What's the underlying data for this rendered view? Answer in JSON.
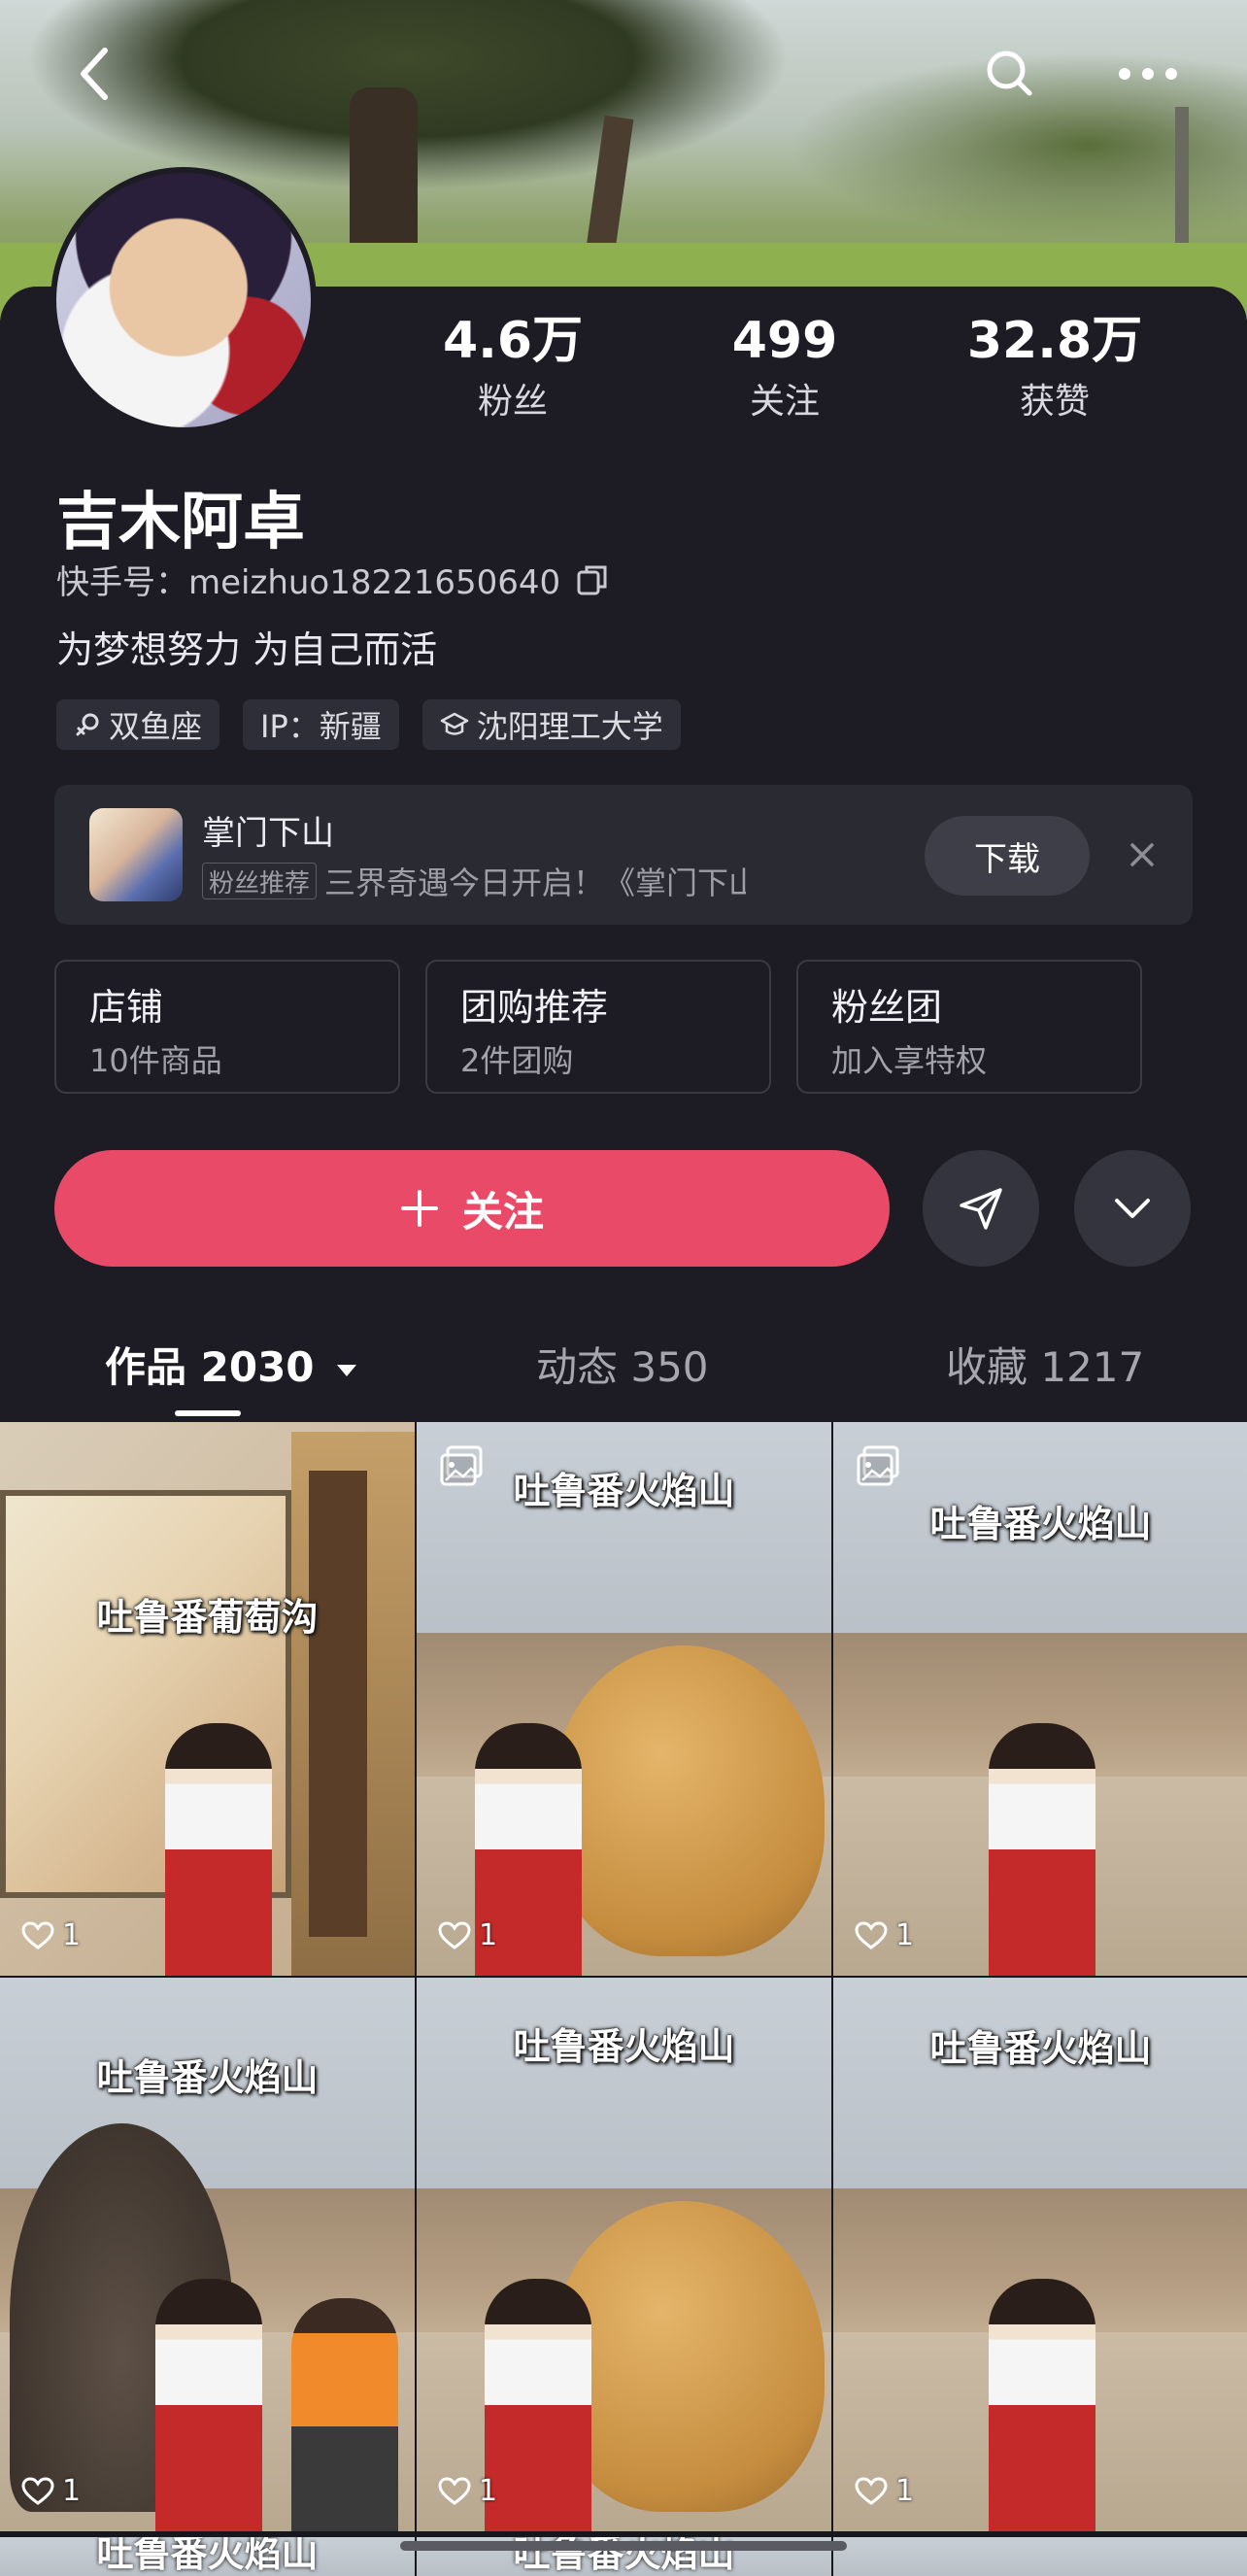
{
  "nav": {
    "back_icon": "chevron-left-icon",
    "search_icon": "search-icon",
    "more_icon": "more-dots-icon"
  },
  "stats": [
    {
      "value": "4.6万",
      "label": "粉丝"
    },
    {
      "value": "499",
      "label": "关注"
    },
    {
      "value": "32.8万",
      "label": "获赞"
    }
  ],
  "profile": {
    "name": "吉木阿卓",
    "kuaishou_id": "快手号：meizhuo18221650640",
    "bio": "为梦想努力 为自己而活",
    "tags": [
      "双鱼座",
      "IP：新疆",
      "沈阳理工大学"
    ]
  },
  "promo": {
    "title": "掌门下山",
    "ad_tag": "粉丝推荐",
    "subtitle": "三界奇遇今日开启！《掌门下山…",
    "download_label": "下载"
  },
  "tiles": [
    {
      "title": "店铺",
      "sub": "10件商品"
    },
    {
      "title": "团购推荐",
      "sub": "2件团购"
    },
    {
      "title": "粉丝团",
      "sub": "加入享特权"
    }
  ],
  "actions": {
    "follow_label": "关注"
  },
  "tabs": [
    {
      "label": "作品 2030"
    },
    {
      "label": "动态 350"
    },
    {
      "label": "收藏 1217"
    }
  ],
  "grid": [
    {
      "caption": "吐鲁番葡萄沟",
      "likes": "1"
    },
    {
      "caption": "吐鲁番火焰山",
      "likes": "1"
    },
    {
      "caption": "吐鲁番火焰山",
      "likes": "1"
    },
    {
      "caption": "吐鲁番火焰山",
      "likes": "1"
    },
    {
      "caption": "吐鲁番火焰山",
      "likes": "1"
    },
    {
      "caption": "吐鲁番火焰山",
      "likes": "1"
    }
  ],
  "partial_row": [
    "吐鲁番火焰山",
    "吐鲁番火焰山",
    ""
  ],
  "colors": {
    "follow": "#e84a67",
    "background": "#1d1c25"
  }
}
